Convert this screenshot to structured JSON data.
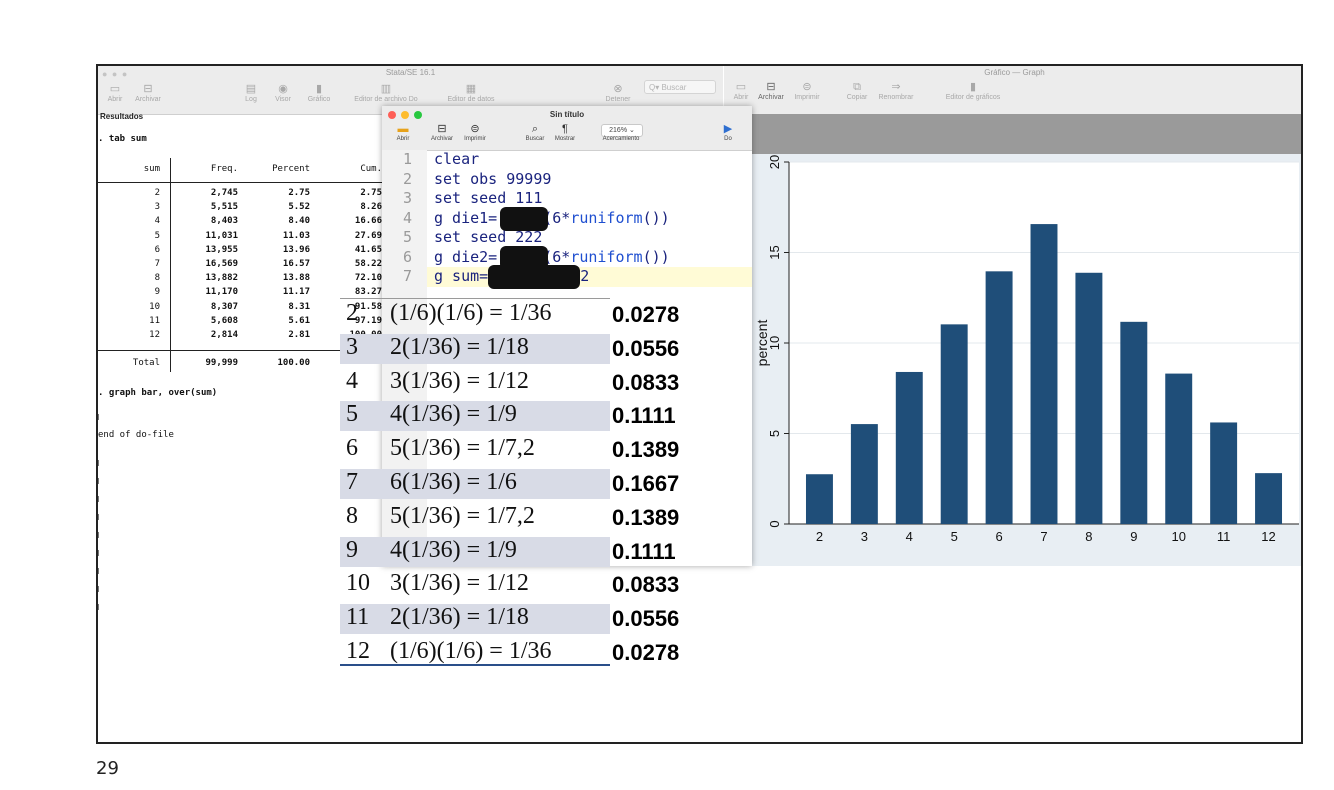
{
  "slide": {
    "page_number": "29"
  },
  "stata_window": {
    "title": "Stata/SE 16.1",
    "toolbar": [
      {
        "label": "Abrir",
        "icon": "folder-icon"
      },
      {
        "label": "Archivar",
        "icon": "save-icon"
      },
      {
        "label": "Log",
        "icon": "log-icon"
      },
      {
        "label": "Visor",
        "icon": "eye-icon"
      },
      {
        "label": "Gráfico",
        "icon": "chart-icon"
      },
      {
        "label": "Editor de archivo Do",
        "icon": "doedit-icon"
      },
      {
        "label": "Editor de datos",
        "icon": "data-editor-icon"
      },
      {
        "label": "Detener",
        "icon": "stop-icon"
      }
    ],
    "search_placeholder": "Buscar",
    "results_label": "Resultados",
    "cmd_tab": ". tab sum",
    "headers": [
      "sum",
      "Freq.",
      "Percent",
      "Cum."
    ],
    "rows": [
      [
        "2",
        "2,745",
        "2.75",
        "2.75"
      ],
      [
        "3",
        "5,515",
        "5.52",
        "8.26"
      ],
      [
        "4",
        "8,403",
        "8.40",
        "16.66"
      ],
      [
        "5",
        "11,031",
        "11.03",
        "27.69"
      ],
      [
        "6",
        "13,955",
        "13.96",
        "41.65"
      ],
      [
        "7",
        "16,569",
        "16.57",
        "58.22"
      ],
      [
        "8",
        "13,882",
        "13.88",
        "72.10"
      ],
      [
        "9",
        "11,170",
        "11.17",
        "83.27"
      ],
      [
        "10",
        "8,307",
        "8.31",
        "91.58"
      ],
      [
        "11",
        "5,608",
        "5.61",
        "97.19"
      ],
      [
        "12",
        "2,814",
        "2.81",
        "100.00"
      ]
    ],
    "total": [
      "Total",
      "99,999",
      "100.00",
      ""
    ],
    "cmd_graph": ". graph bar, over(sum)",
    "end_line": "end of do-file"
  },
  "graph_window": {
    "title": "Gráfico — Graph",
    "toolbar": [
      {
        "label": "Abrir",
        "icon": "folder-icon"
      },
      {
        "label": "Archivar",
        "icon": "save-icon"
      },
      {
        "label": "Imprimir",
        "icon": "print-icon"
      },
      {
        "label": "Copiar",
        "icon": "copy-icon"
      },
      {
        "label": "Renombrar",
        "icon": "rename-icon"
      },
      {
        "label": "Editor de gráficos",
        "icon": "graph-editor-icon"
      }
    ]
  },
  "do_editor": {
    "title": "Sin título",
    "toolbar": [
      {
        "label": "Abrir",
        "icon": "folder-icon"
      },
      {
        "label": "Archivar",
        "icon": "save-icon"
      },
      {
        "label": "Imprimir",
        "icon": "print-icon"
      },
      {
        "label": "Buscar",
        "icon": "search-icon"
      },
      {
        "label": "Mostrar",
        "icon": "pilcrow-icon"
      },
      {
        "label": "Acercamiento",
        "icon": "zoom-icon"
      },
      {
        "label": "Do",
        "icon": "run-icon"
      }
    ],
    "zoom": "216%",
    "code_lines": [
      {
        "n": "1",
        "text": "clear"
      },
      {
        "n": "2",
        "text": "set obs 99999"
      },
      {
        "n": "3",
        "text": "set seed 111"
      },
      {
        "n": "4",
        "pre": "g die1=",
        "post": "(6*",
        "fn": "runiform",
        "tail": "())"
      },
      {
        "n": "5",
        "text": "set seed 222"
      },
      {
        "n": "6",
        "pre": "g die2=",
        "post": "(6*",
        "fn": "runiform",
        "tail": "())"
      },
      {
        "n": "7",
        "pre": "g sum=",
        "post": "2",
        "fn": "",
        "tail": ""
      }
    ]
  },
  "probability_table": [
    {
      "sum": "2",
      "expr": "(1/6)(1/6) = 1/36",
      "value": "0.0278"
    },
    {
      "sum": "3",
      "expr": "2(1/36) = 1/18",
      "value": "0.0556"
    },
    {
      "sum": "4",
      "expr": "3(1/36) = 1/12",
      "value": "0.0833"
    },
    {
      "sum": "5",
      "expr": "4(1/36) = 1/9",
      "value": "0.1111"
    },
    {
      "sum": "6",
      "expr": "5(1/36) = 1/7,2",
      "value": "0.1389"
    },
    {
      "sum": "7",
      "expr": "6(1/36) = 1/6",
      "value": "0.1667"
    },
    {
      "sum": "8",
      "expr": "5(1/36) = 1/7,2",
      "value": "0.1389"
    },
    {
      "sum": "9",
      "expr": "4(1/36) = 1/9",
      "value": "0.1111"
    },
    {
      "sum": "10",
      "expr": "3(1/36) = 1/12",
      "value": "0.0833"
    },
    {
      "sum": "11",
      "expr": "2(1/36) = 1/18",
      "value": "0.0556"
    },
    {
      "sum": "12",
      "expr": "(1/6)(1/6) = 1/36",
      "value": "0.0278"
    }
  ],
  "chart_data": {
    "type": "bar",
    "categories": [
      "2",
      "3",
      "4",
      "5",
      "6",
      "7",
      "8",
      "9",
      "10",
      "11",
      "12"
    ],
    "values": [
      2.75,
      5.52,
      8.4,
      11.03,
      13.96,
      16.57,
      13.88,
      11.17,
      8.31,
      5.61,
      2.81
    ],
    "ylabel": "percent",
    "xlabel": "",
    "yticks": [
      "0",
      "5",
      "10",
      "15",
      "20"
    ],
    "ylim": [
      0,
      20
    ],
    "bar_color": "#1f4e79",
    "background": "#e8eef3",
    "grid": true
  }
}
